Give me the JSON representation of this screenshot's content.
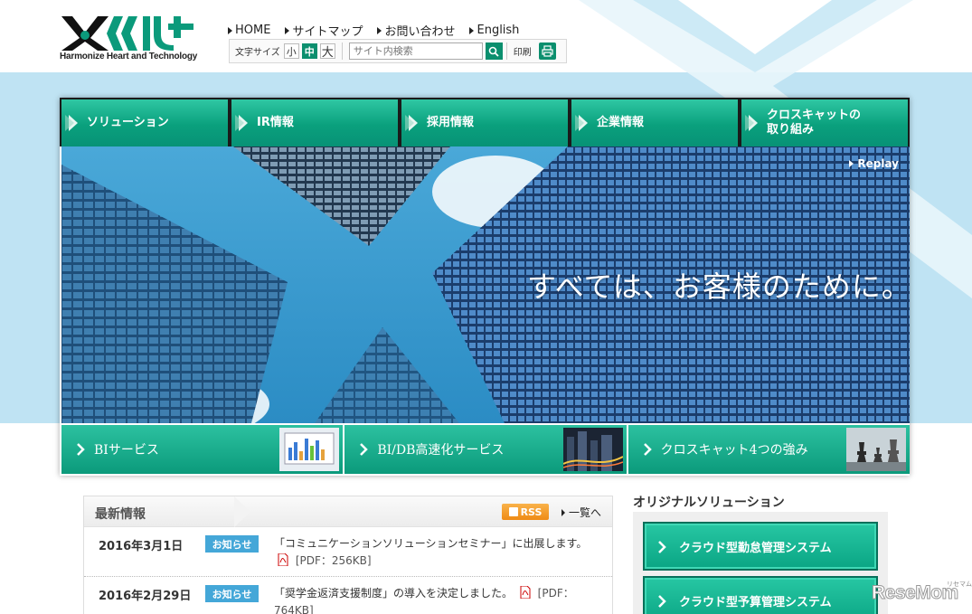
{
  "logo": {
    "tagline": "Harmonize Heart and Technology"
  },
  "top_links": [
    "HOME",
    "サイトマップ",
    "お問い合わせ",
    "English"
  ],
  "toolbar": {
    "font_size_label": "文字サイズ",
    "font_sizes": [
      "小",
      "中",
      "大"
    ],
    "selected_font_size": "中",
    "search_placeholder": "サイト内検索",
    "print_label": "印刷"
  },
  "nav": [
    {
      "label": "ソリューション"
    },
    {
      "label": "IR情報"
    },
    {
      "label": "採用情報"
    },
    {
      "label": "企業情報"
    },
    {
      "label": "クロスキャットの\n取り組み"
    }
  ],
  "hero": {
    "headline": "すべては、お客様のために。",
    "replay_label": "Replay"
  },
  "services": [
    {
      "label": "BIサービス"
    },
    {
      "label": "BI/DB高速化サービス"
    },
    {
      "label": "クロスキャット4つの強み"
    }
  ],
  "news": {
    "title": "最新情報",
    "rss_label": "RSS",
    "more_label": "一覧へ",
    "items": [
      {
        "date": "2016年3月1日",
        "category": "お知らせ",
        "text_before": "「コミュニケーションソリューションセミナー」に出展します。",
        "file_info": "[PDF：256KB]"
      },
      {
        "date": "2016年2月29日",
        "category": "お知らせ",
        "text_before": "「奨学金返済支援制度」の導入を決定しました。",
        "file_info": "[PDF：764KB]"
      }
    ]
  },
  "original_solutions": {
    "title": "オリジナルソリューション",
    "items": [
      {
        "label": "クラウド型勤怠管理システム"
      },
      {
        "label": "クラウド型予算管理システム"
      }
    ]
  },
  "watermark": {
    "text": "ReseMom",
    "small": "リセマム"
  },
  "colors": {
    "brand_green": "#0b9a7b",
    "sky_band": "#bfe3f3",
    "badge_blue": "#44a7d8",
    "rss_orange": "#ef8b14"
  }
}
